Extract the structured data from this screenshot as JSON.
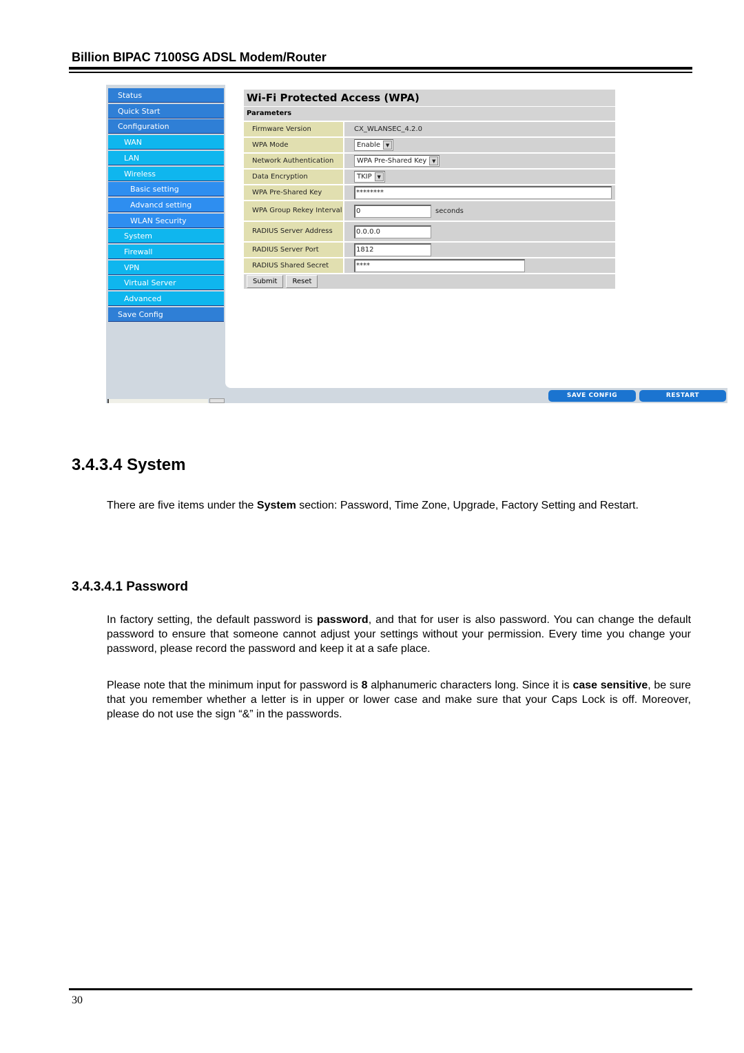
{
  "header": {
    "title": "Billion BIPAC 7100SG ADSL Modem/Router"
  },
  "screenshot": {
    "sidebar": {
      "items": [
        {
          "label": "Status",
          "level": 0
        },
        {
          "label": "Quick Start",
          "level": 0
        },
        {
          "label": "Configuration",
          "level": 0
        },
        {
          "label": "WAN",
          "level": 1
        },
        {
          "label": "LAN",
          "level": 1
        },
        {
          "label": "Wireless",
          "level": 1
        },
        {
          "label": "Basic setting",
          "level": 2
        },
        {
          "label": "Advancd setting",
          "level": 2
        },
        {
          "label": "WLAN Security",
          "level": 2
        },
        {
          "label": "System",
          "level": 1
        },
        {
          "label": "Firewall",
          "level": 1
        },
        {
          "label": "VPN",
          "level": 1
        },
        {
          "label": "Virtual Server",
          "level": 1
        },
        {
          "label": "Advanced",
          "level": 1
        },
        {
          "label": "Save Config",
          "level": 0
        }
      ]
    },
    "panel": {
      "title": "Wi-Fi Protected Access (WPA)",
      "subtitle": "Parameters",
      "firmware_label": "Firmware Version",
      "firmware_value": "CX_WLANSEC_4.2.0",
      "wpa_mode_label": "WPA Mode",
      "wpa_mode_value": "Enable",
      "net_auth_label": "Network Authentication",
      "net_auth_value": "WPA Pre-Shared Key",
      "encryption_label": "Data Encryption",
      "encryption_value": "TKIP",
      "psk_label": "WPA Pre-Shared Key",
      "psk_value": "********",
      "rekey_label": "WPA Group Rekey Interval",
      "rekey_value": "0",
      "rekey_unit": "seconds",
      "radius_addr_label": "RADIUS Server Address",
      "radius_addr_value": "0.0.0.0",
      "radius_port_label": "RADIUS Server Port",
      "radius_port_value": "1812",
      "radius_secret_label": "RADIUS Shared Secret",
      "radius_secret_value": "****",
      "submit_label": "Submit",
      "reset_label": "Reset"
    },
    "bottom": {
      "save_config_label": "SAVE CONFIG",
      "restart_label": "RESTART"
    }
  },
  "section": {
    "heading": "3.4.3.4 System",
    "intro_pre": "There are five items under the ",
    "intro_bold": "System",
    "intro_post": " section: Password, Time Zone, Upgrade, Factory Setting and Restart."
  },
  "subsection": {
    "heading": "3.4.3.4.1 Password",
    "p1_pre": "In factory setting, the default password is ",
    "p1_bold": "password",
    "p1_post": ", and that for user is also password. You can change the default password to ensure that someone cannot adjust your settings without your permission. Every time you change your password, please record the password and keep it at a safe place.",
    "p2_a": "Please note that the minimum input for password is ",
    "p2_b": "8",
    "p2_c": " alphanumeric characters long. Since it is ",
    "p2_d": "case sensitive",
    "p2_e": ", be sure that you remember whether a letter is in upper or lower case and make sure that your Caps Lock is off. Moreover, please do not use the sign “&” in the passwords."
  },
  "footer": {
    "page_number": "30"
  }
}
